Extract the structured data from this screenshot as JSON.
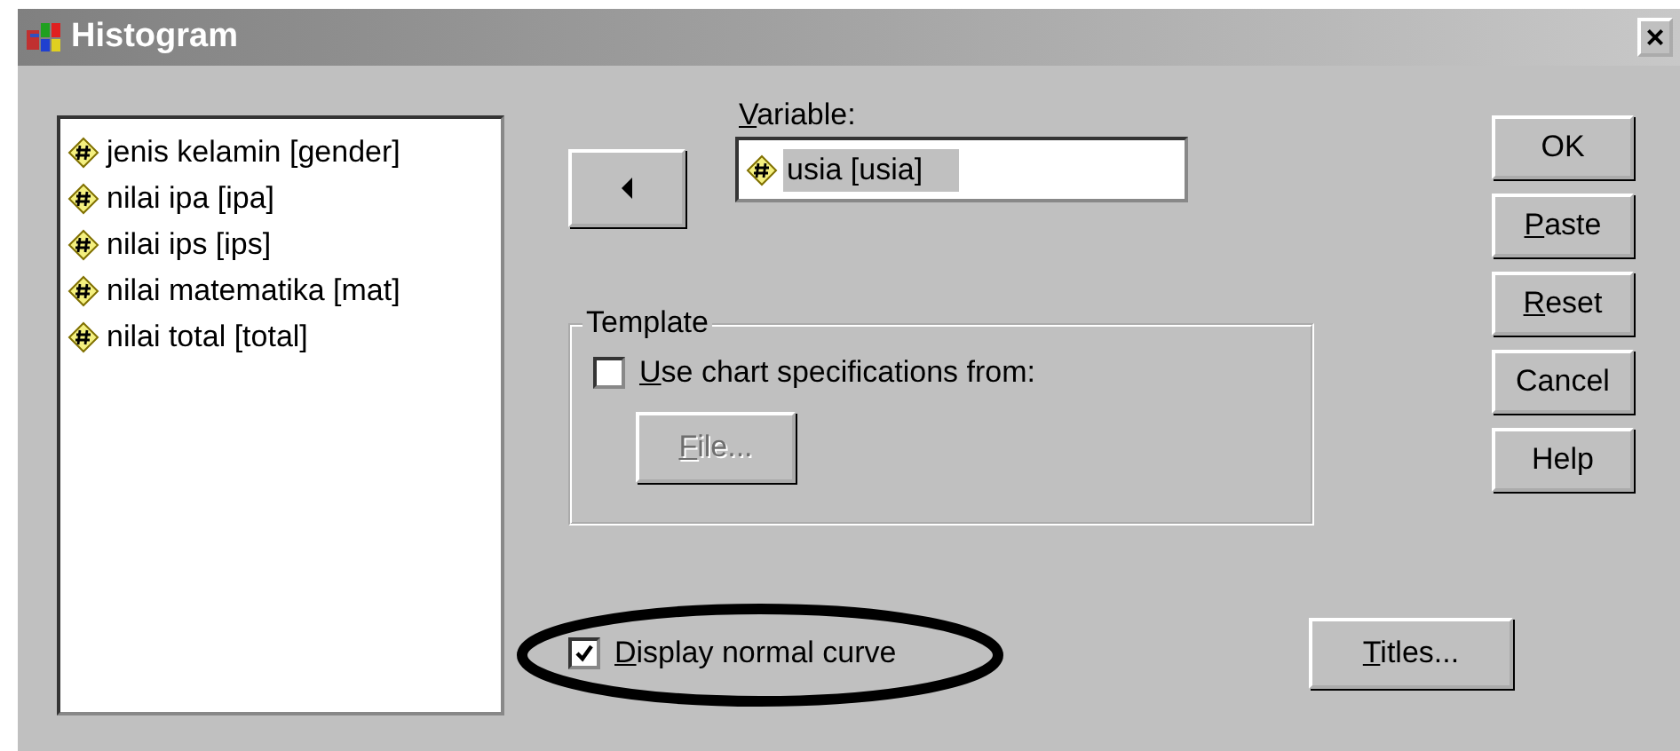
{
  "window": {
    "title": "Histogram",
    "close": "×"
  },
  "variables": [
    {
      "label": "jenis kelamin [gender]",
      "selected": false
    },
    {
      "label": "nilai ipa [ipa]",
      "selected": false
    },
    {
      "label": "nilai ips [ips]",
      "selected": false
    },
    {
      "label": "nilai matematika [mat]",
      "selected": false
    },
    {
      "label": "nilai total [total]",
      "selected": false
    }
  ],
  "move_button": {
    "kind": "left"
  },
  "variable_field": {
    "label": "Variable:",
    "value": "usia [usia]",
    "selected": true
  },
  "template": {
    "title": "Template",
    "checkbox": {
      "label": "Use chart specifications from:",
      "checked": false
    },
    "file_button": {
      "label": "File...",
      "disabled": true
    }
  },
  "buttons": [
    {
      "label": "OK",
      "mnemonic": false
    },
    {
      "label": "Paste",
      "mnemonic": true
    },
    {
      "label": "Reset",
      "mnemonic": true
    },
    {
      "label": "Cancel",
      "mnemonic": false
    },
    {
      "label": "Help",
      "mnemonic": false
    }
  ],
  "normal_curve": {
    "label": "Display normal curve",
    "checked": true
  },
  "titles_button": {
    "label": "Titles..."
  },
  "highlight": {
    "kind": "ellipse"
  }
}
